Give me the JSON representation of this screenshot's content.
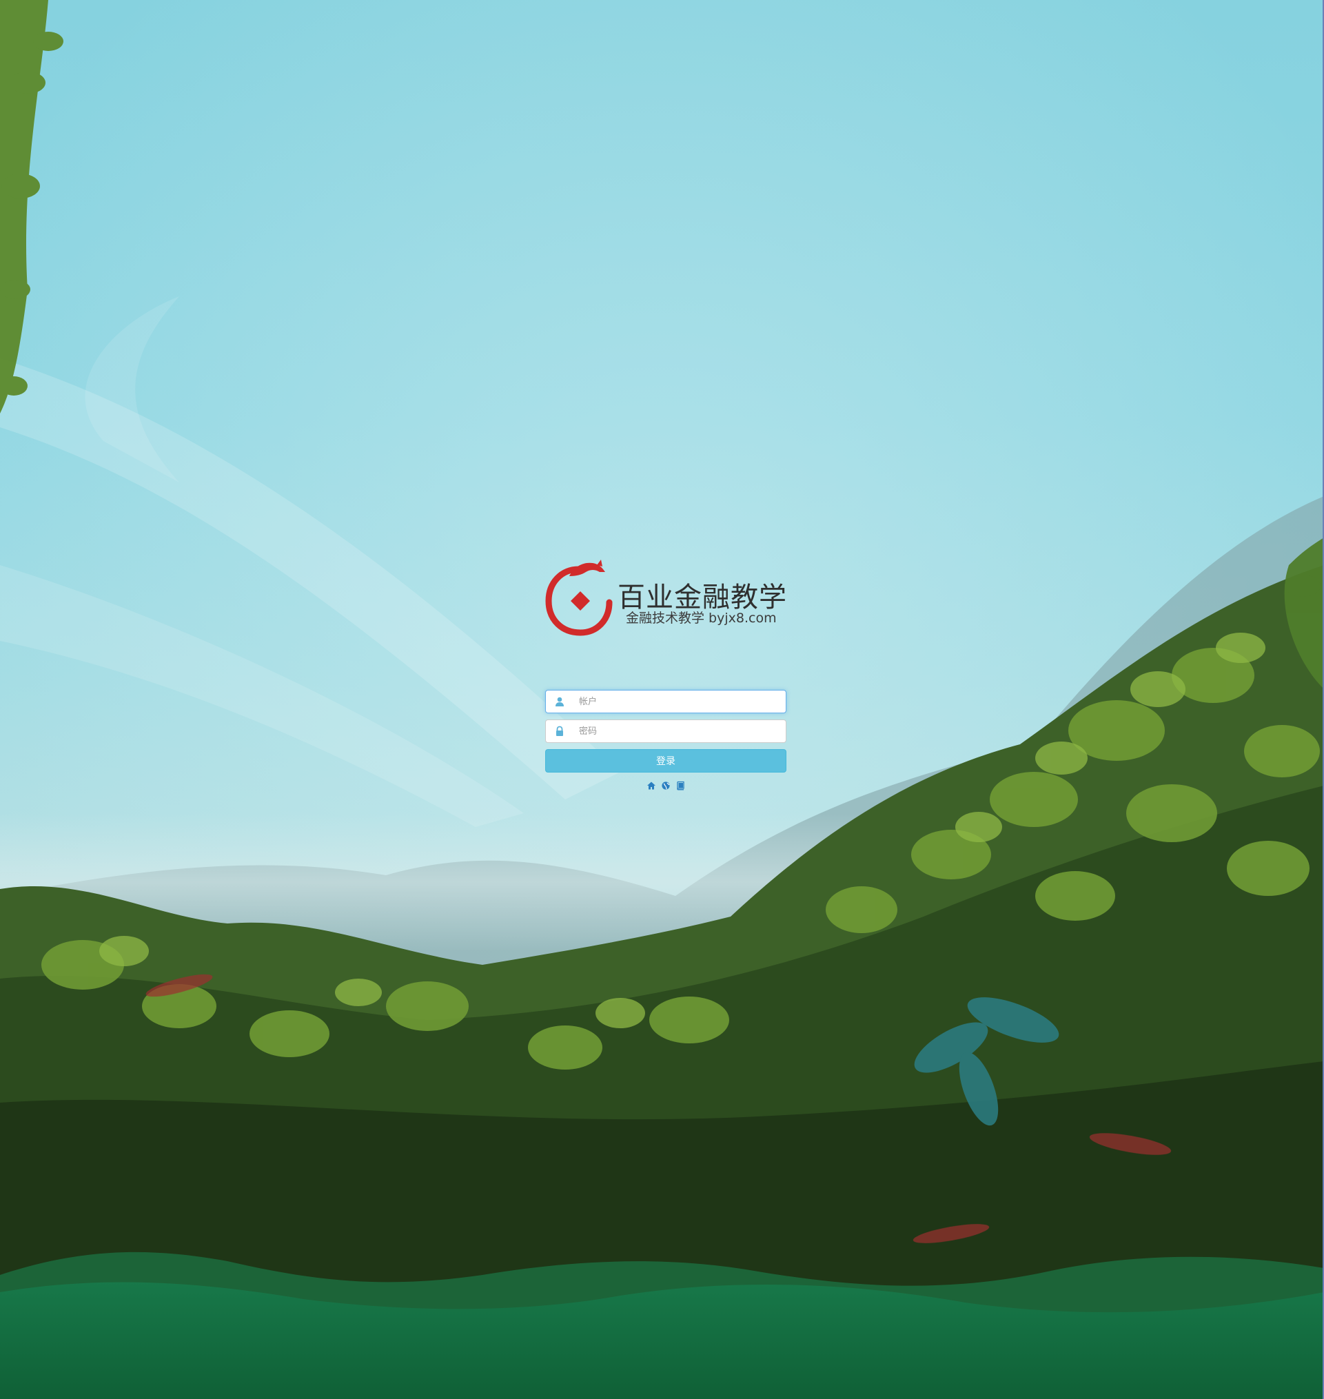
{
  "brand": {
    "title": "百业金融教学",
    "subtitle": "金融技术教学 byjx8.com",
    "logo_color": "#d12b2b"
  },
  "login": {
    "account_placeholder": "帐户",
    "password_placeholder": "密码",
    "submit_label": "登录",
    "focus_color": "#66afe9",
    "button_color": "#5bc0de"
  },
  "footer_links": [
    {
      "icon": "home-icon"
    },
    {
      "icon": "globe-icon"
    },
    {
      "icon": "book-icon"
    }
  ],
  "icons": {
    "account_field": "user-icon",
    "password_field": "lock-icon"
  }
}
